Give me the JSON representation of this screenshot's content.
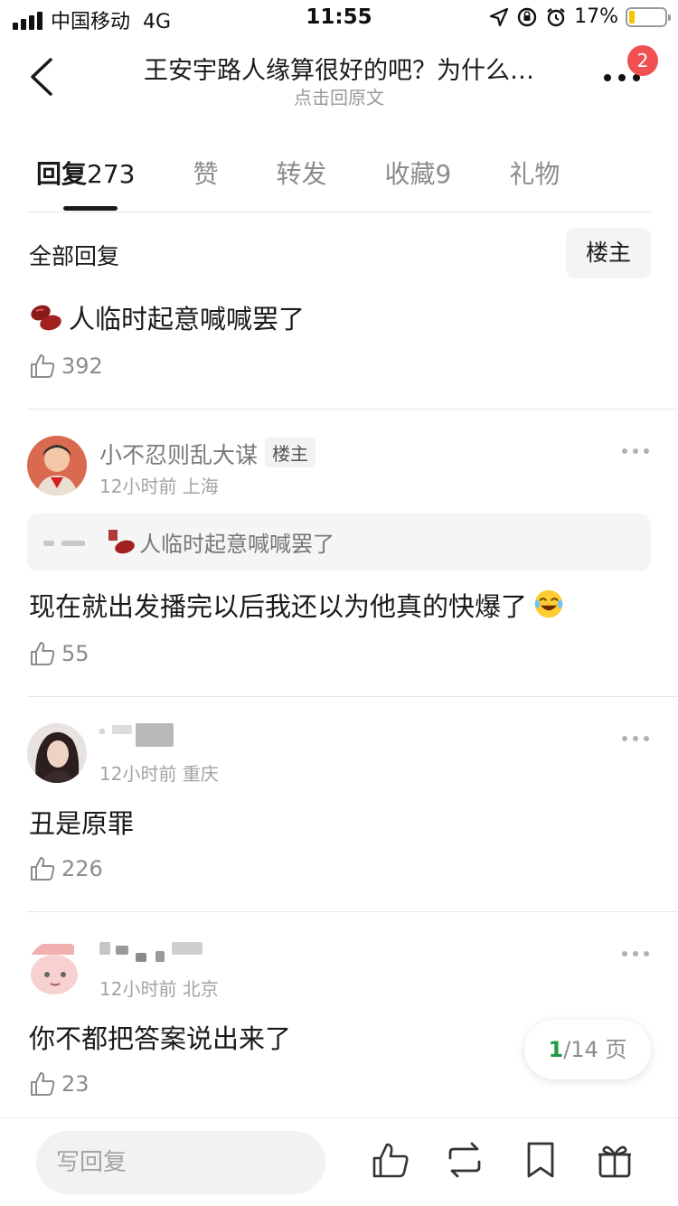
{
  "status_bar": {
    "carrier": "中国移动",
    "network": "4G",
    "time": "11:55",
    "battery": "17%",
    "battery_level": 0.17
  },
  "nav": {
    "title": "王安宇路人缘算很好的吧？为什么…",
    "subtitle": "点击回原文",
    "badge": "2"
  },
  "tabs": [
    {
      "label": "回复",
      "count": "273"
    },
    {
      "label": "赞",
      "count": ""
    },
    {
      "label": "转发",
      "count": ""
    },
    {
      "label": "收藏",
      "count": "9"
    },
    {
      "label": "礼物",
      "count": ""
    }
  ],
  "section": {
    "title": "全部回复",
    "filter": "楼主"
  },
  "post": {
    "text": "人临时起意喊喊罢了",
    "likes": "392"
  },
  "comments": [
    {
      "name": "小不忍则乱大谋",
      "tag": "楼主",
      "meta": "12小时前 上海",
      "quote": "人临时起意喊喊罢了",
      "text": "现在就出发播完以后我还以为他真的快爆了",
      "likes": "55"
    },
    {
      "name": "",
      "meta": "12小时前 重庆",
      "text": "丑是原罪",
      "likes": "226"
    },
    {
      "name": "",
      "meta": "12小时前 北京",
      "text": "你不都把答案说出来了",
      "likes": "23"
    }
  ],
  "pager": {
    "current": "1",
    "total": "/14",
    "unit": " 页"
  },
  "bottom_bar": {
    "reply_placeholder": "写回复"
  },
  "colors": {
    "accent_green": "#1f9d46",
    "badge_red": "#f05050",
    "battery_yellow": "#f5c400"
  }
}
